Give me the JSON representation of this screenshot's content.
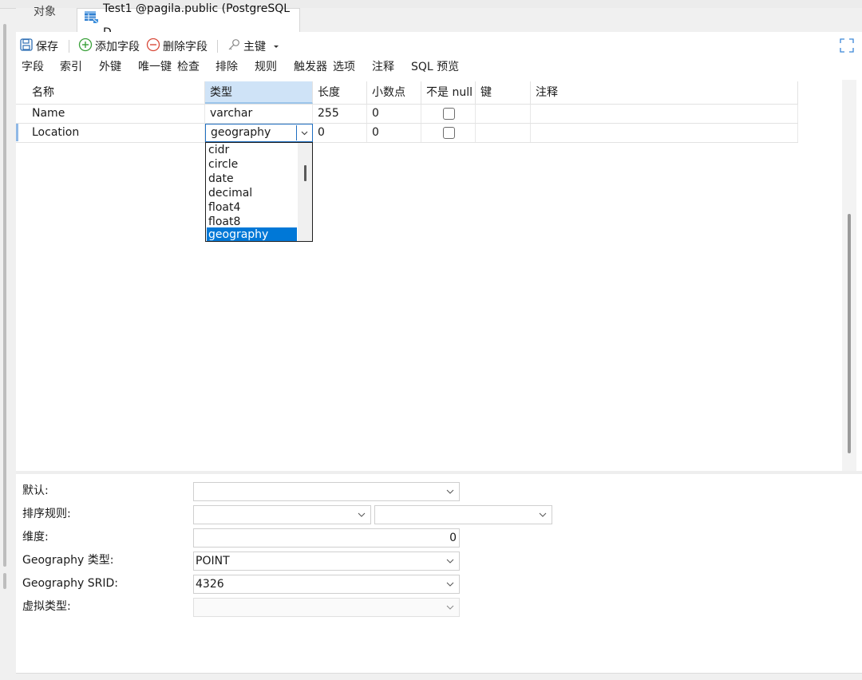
{
  "tabs": {
    "objects": "对象",
    "active": "Test1 @pagila.public (PostgreSQL D..."
  },
  "toolbar": {
    "save": "保存",
    "add_field": "添加字段",
    "delete_field": "删除字段",
    "primary_key": "主键"
  },
  "subtabs": [
    "字段",
    "索引",
    "外键",
    "唯一键",
    "检查",
    "排除",
    "规则",
    "触发器",
    "选项",
    "注释",
    "SQL 预览"
  ],
  "grid": {
    "headers": [
      "名称",
      "类型",
      "长度",
      "小数点",
      "不是 null",
      "键",
      "注释"
    ],
    "rows": [
      {
        "name": "Name",
        "type": "varchar",
        "length": "255",
        "decimals": "0",
        "not_null": false
      },
      {
        "name": "Location",
        "type": "geography",
        "length": "0",
        "decimals": "0",
        "not_null": false
      }
    ]
  },
  "type_dropdown": {
    "items": [
      "cidr",
      "circle",
      "date",
      "decimal",
      "float4",
      "float8",
      "geography"
    ],
    "selected": "geography"
  },
  "properties": {
    "default_label": "默认:",
    "default_value": "",
    "collation_label": "排序规则:",
    "dimension_label": "维度:",
    "dimension_value": "0",
    "geo_type_label": "Geography 类型:",
    "geo_type_value": "POINT",
    "geo_srid_label": "Geography SRID:",
    "geo_srid_value": "4326",
    "virtual_type_label": "虚拟类型:",
    "virtual_type_value": ""
  },
  "colors": {
    "accent": "#0078d7",
    "header_selected": "#cfe3f7"
  }
}
